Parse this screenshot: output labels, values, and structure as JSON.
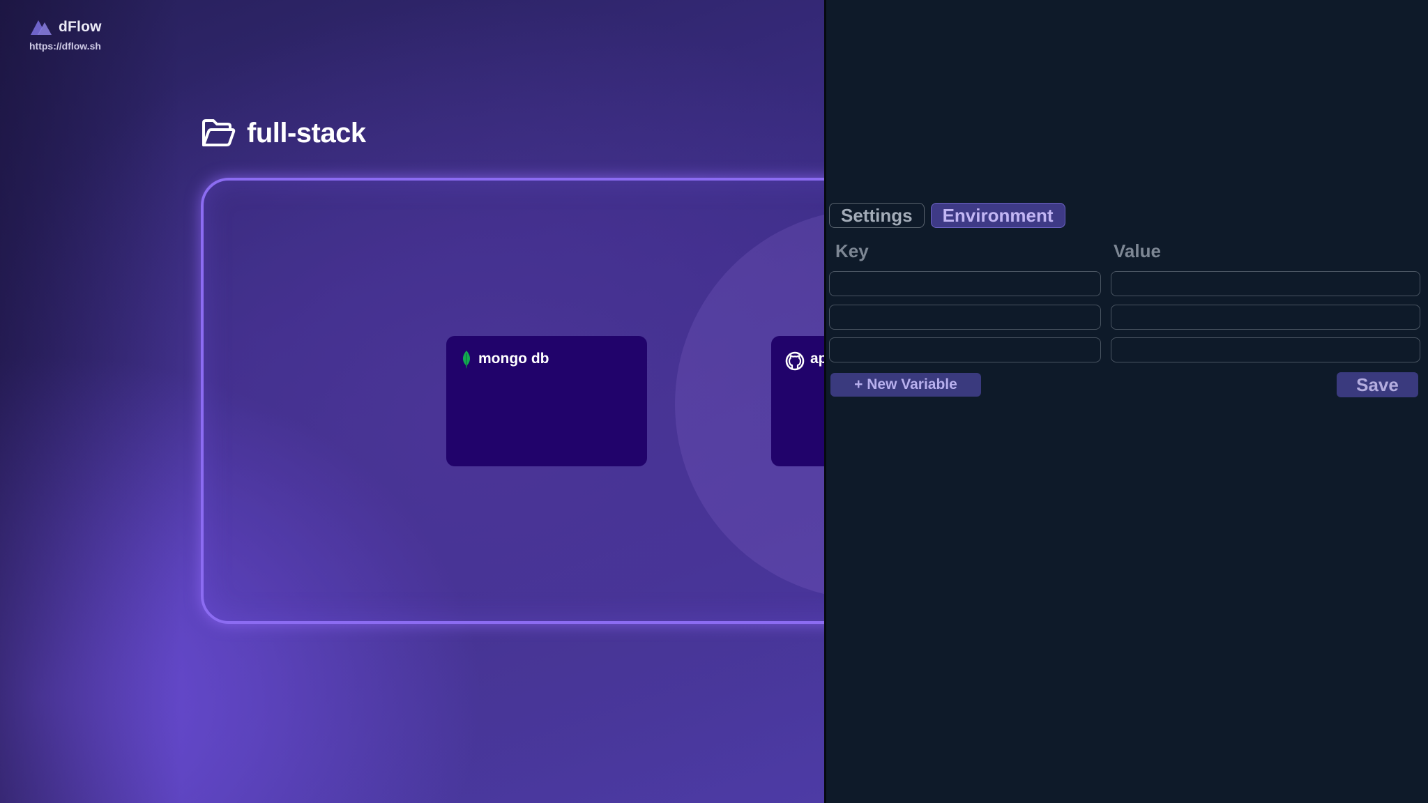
{
  "brand": {
    "name": "dFlow",
    "url": "https://dflow.sh",
    "logo_icon": "dflow-logo-icon"
  },
  "project": {
    "name": "full-stack",
    "icon": "folder-open-icon"
  },
  "services": [
    {
      "label": "mongo db",
      "icon": "mongodb-leaf-icon"
    },
    {
      "label": "ap",
      "icon": "github-icon"
    }
  ],
  "panel": {
    "tabs": [
      {
        "label": "Settings",
        "active": false
      },
      {
        "label": "Environment",
        "active": true
      }
    ],
    "columns": {
      "key": "Key",
      "value": "Value"
    },
    "rows": [
      {
        "key": "",
        "value": ""
      },
      {
        "key": "",
        "value": ""
      },
      {
        "key": "",
        "value": ""
      }
    ],
    "new_variable_label": "+ New Variable",
    "save_label": "Save"
  },
  "colors": {
    "accent": "#8c6cf2",
    "card_bg": "#21036b",
    "panel_bg": "#0e1a29",
    "button_bg": "#3a3a7e",
    "mongo_green": "#13aa52"
  }
}
